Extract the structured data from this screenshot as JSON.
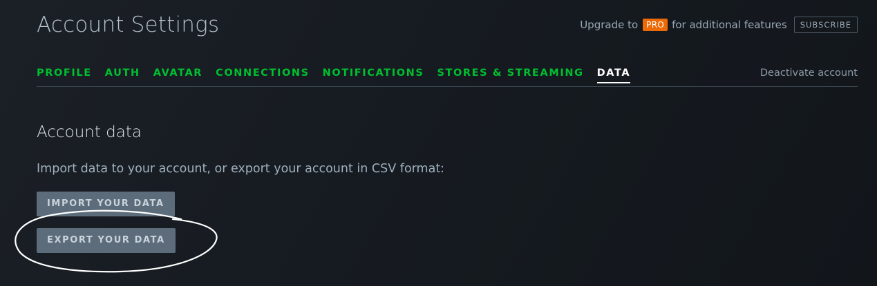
{
  "header": {
    "title": "Account Settings",
    "upgrade_prefix": "Upgrade to",
    "pro_badge": "PRO",
    "upgrade_suffix": "for additional features",
    "subscribe_label": "SUBSCRIBE"
  },
  "tabs": [
    {
      "label": "PROFILE",
      "active": false
    },
    {
      "label": "AUTH",
      "active": false
    },
    {
      "label": "AVATAR",
      "active": false
    },
    {
      "label": "CONNECTIONS",
      "active": false
    },
    {
      "label": "NOTIFICATIONS",
      "active": false
    },
    {
      "label": "STORES & STREAMING",
      "active": false
    },
    {
      "label": "DATA",
      "active": true
    }
  ],
  "deactivate_label": "Deactivate account",
  "section": {
    "title": "Account data",
    "description": "Import data to your account, or export your account in CSV format:",
    "import_label": "IMPORT YOUR DATA",
    "export_label": "EXPORT YOUR DATA"
  },
  "colors": {
    "background": "#161b21",
    "tab_green": "#00c030",
    "pro_orange": "#ee6a06",
    "button_bg": "#5d6c7a"
  }
}
